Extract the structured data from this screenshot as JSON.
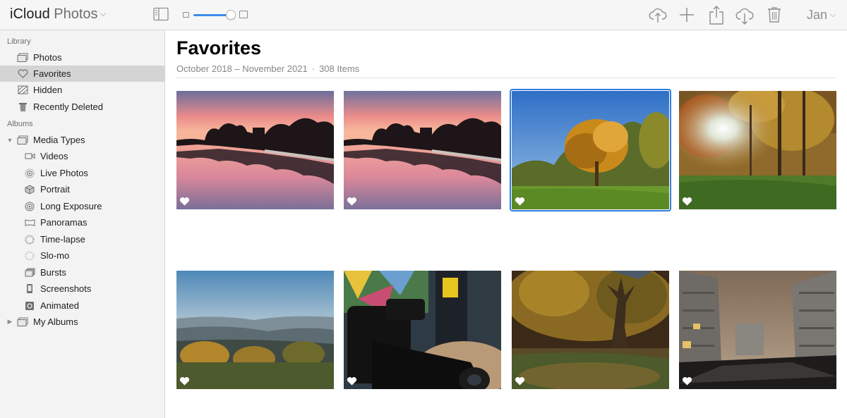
{
  "toolbar": {
    "app_name": "iCloud",
    "app_section": "Photos",
    "user_name": "Jan"
  },
  "sidebar": {
    "library_header": "Library",
    "library_items": [
      {
        "label": "Photos",
        "icon": "photos-stack-icon"
      },
      {
        "label": "Favorites",
        "icon": "heart-icon",
        "selected": true
      },
      {
        "label": "Hidden",
        "icon": "hidden-icon"
      },
      {
        "label": "Recently Deleted",
        "icon": "trash-icon"
      }
    ],
    "albums_header": "Albums",
    "media_types": {
      "label": "Media Types",
      "expanded": true,
      "children": [
        {
          "label": "Videos",
          "icon": "video-icon"
        },
        {
          "label": "Live Photos",
          "icon": "live-photo-icon"
        },
        {
          "label": "Portrait",
          "icon": "cube-icon"
        },
        {
          "label": "Long Exposure",
          "icon": "long-exposure-icon"
        },
        {
          "label": "Panoramas",
          "icon": "panorama-icon"
        },
        {
          "label": "Time-lapse",
          "icon": "time-lapse-icon"
        },
        {
          "label": "Slo-mo",
          "icon": "slo-mo-icon"
        },
        {
          "label": "Bursts",
          "icon": "bursts-icon"
        },
        {
          "label": "Screenshots",
          "icon": "screenshot-icon"
        },
        {
          "label": "Animated",
          "icon": "animated-icon"
        }
      ]
    },
    "my_albums": {
      "label": "My Albums",
      "expanded": false
    }
  },
  "main": {
    "title": "Favorites",
    "date_range": "October 2018 – November 2021",
    "separator": "·",
    "item_count": "308 Items",
    "photos": [
      {
        "subject": "sunset-river-reflection",
        "favorite": true
      },
      {
        "subject": "sunset-river-reflection",
        "favorite": true
      },
      {
        "subject": "autumn-tree-meadow",
        "favorite": true,
        "selected": true
      },
      {
        "subject": "autumn-forest-sunburst",
        "favorite": true
      },
      {
        "subject": "misty-hills-landscape",
        "favorite": true
      },
      {
        "subject": "nikon-camera-closeup",
        "favorite": true
      },
      {
        "subject": "autumn-tree-night",
        "favorite": true
      },
      {
        "subject": "night-street-buildings",
        "favorite": true
      }
    ]
  },
  "colors": {
    "accent": "#3a8be8",
    "selection": "#2f7de1",
    "sidebar_selected": "#d4d4d4"
  }
}
